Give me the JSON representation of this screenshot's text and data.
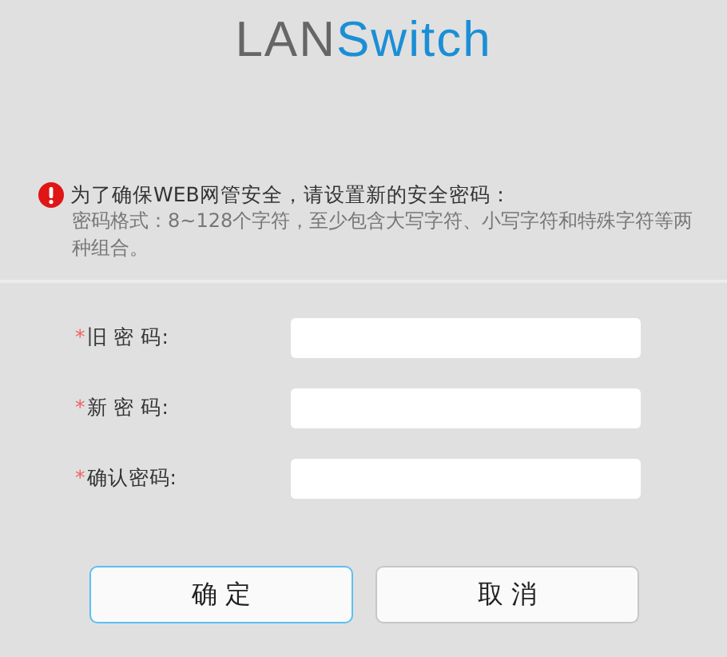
{
  "logo": {
    "part_1": "LAN",
    "part_2": "Switch"
  },
  "notice": {
    "title": "为了确保WEB网管安全，请设置新的安全密码：",
    "detail": "密码格式：8~128个字符，至少包含大写字符、小写字符和特殊字符等两种组合。"
  },
  "fields": [
    {
      "marker": "*",
      "label": "旧 密 码:"
    },
    {
      "marker": "*",
      "label": "新 密 码:"
    },
    {
      "marker": "*",
      "label": "确认密码:"
    }
  ],
  "buttons": [
    {
      "label": "确 定",
      "focused": true
    },
    {
      "label": "取 消",
      "focused": false
    }
  ]
}
